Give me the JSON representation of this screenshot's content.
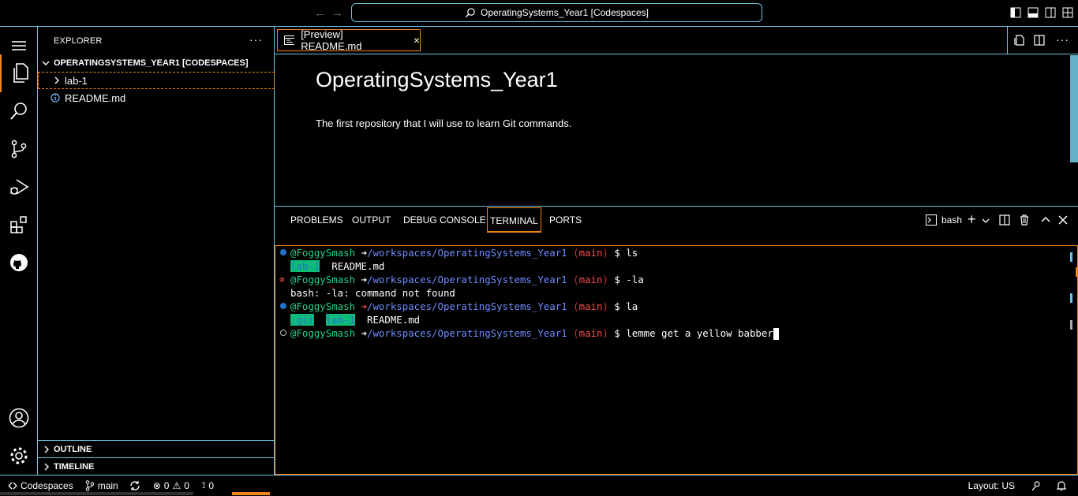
{
  "titlebar": {
    "title": "OperatingSystems_Year1 [Codespaces]"
  },
  "sidebar": {
    "header": "EXPLORER",
    "more": "···",
    "root": "OPERATINGSYSTEMS_YEAR1 [CODESPACES]",
    "items": [
      {
        "label": "lab-1",
        "kind": "folder"
      },
      {
        "label": "README.md",
        "kind": "file"
      }
    ],
    "outline": "OUTLINE",
    "timeline": "TIMELINE"
  },
  "editor": {
    "tab_label": "[Preview] README.md",
    "heading": "OperatingSystems_Year1",
    "paragraph": "The first repository that I will use to learn Git commands."
  },
  "panel": {
    "tabs": [
      "PROBLEMS",
      "OUTPUT",
      "DEBUG CONSOLE",
      "TERMINAL",
      "PORTS"
    ],
    "active_tab": "TERMINAL",
    "shell": "bash"
  },
  "terminal": {
    "user": "@FoggySmash",
    "arrow": "➜",
    "path": "/workspaces/OperatingSystems_Year1",
    "branch_open": "(",
    "branch": "main",
    "branch_close": ")",
    "prompt": "$",
    "cmd1": "ls",
    "ls1_a": "lab-1",
    "ls1_b": "README.md",
    "cmd2": "-la",
    "err": "bash: -la: command not found",
    "cmd3": "la",
    "la_a": ".git",
    "la_b": "lab-1",
    "la_c": "README.md",
    "cmd4": "lemme get a yellow babber"
  },
  "status": {
    "remote": "Codespaces",
    "branch": "main",
    "errors": "0",
    "warnings": "0",
    "ports": "0",
    "layout": "Layout: US"
  },
  "colors": {
    "border": "#6fc3df",
    "active_border": "#f38518",
    "term_green": "#23d18b",
    "term_blue": "#6e8cff",
    "term_red": "#f14c4c"
  }
}
